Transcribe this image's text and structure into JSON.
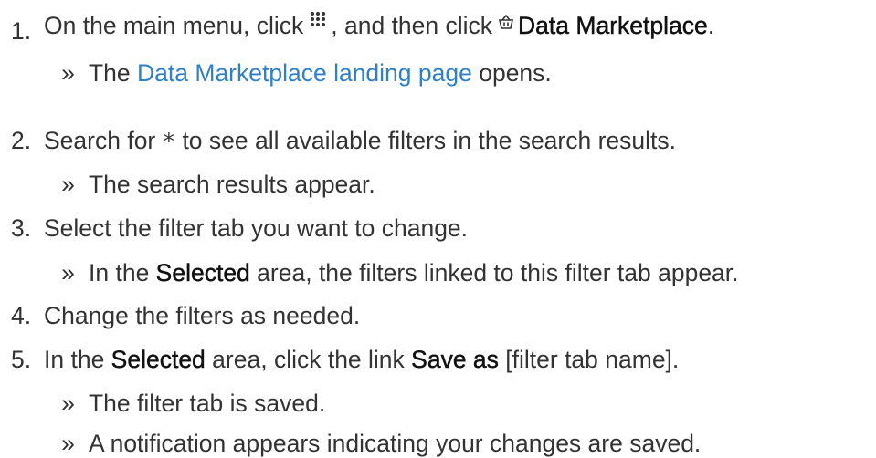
{
  "steps": [
    {
      "number": "1.",
      "text_a": "On the main menu, click",
      "icon_a": "apps-grid-icon",
      "text_b": ", and then click",
      "icon_b": "basket-icon",
      "bold_b": "Data Marketplace",
      "text_c": ".",
      "results": [
        {
          "marker": "»",
          "text_a": "The ",
          "link": "Data Marketplace landing page",
          "text_b": " opens."
        }
      ]
    },
    {
      "number": "2.",
      "text_a": "Search for ",
      "code": "*",
      "text_b": " to see all available filters in the search results.",
      "results": [
        {
          "marker": "»",
          "text": "The search results appear."
        }
      ]
    },
    {
      "number": "3.",
      "text": "Select the filter tab you want to change.",
      "results": [
        {
          "marker": "»",
          "text_a": "In the ",
          "bold": "Selected",
          "text_b": " area, the filters linked to this filter tab appear."
        }
      ]
    },
    {
      "number": "4.",
      "text": "Change the filters as needed."
    },
    {
      "number": "5.",
      "text_a": "In the ",
      "bold_a": "Selected",
      "text_b": " area, click the link ",
      "bold_b": "Save as",
      "text_c": " [filter tab name].",
      "results": [
        {
          "marker": "»",
          "text": "The filter tab is saved."
        },
        {
          "marker": "»",
          "text": "A notification appears indicating your changes are saved."
        }
      ]
    }
  ],
  "colors": {
    "text": "#333333",
    "link": "#2f80c8"
  }
}
